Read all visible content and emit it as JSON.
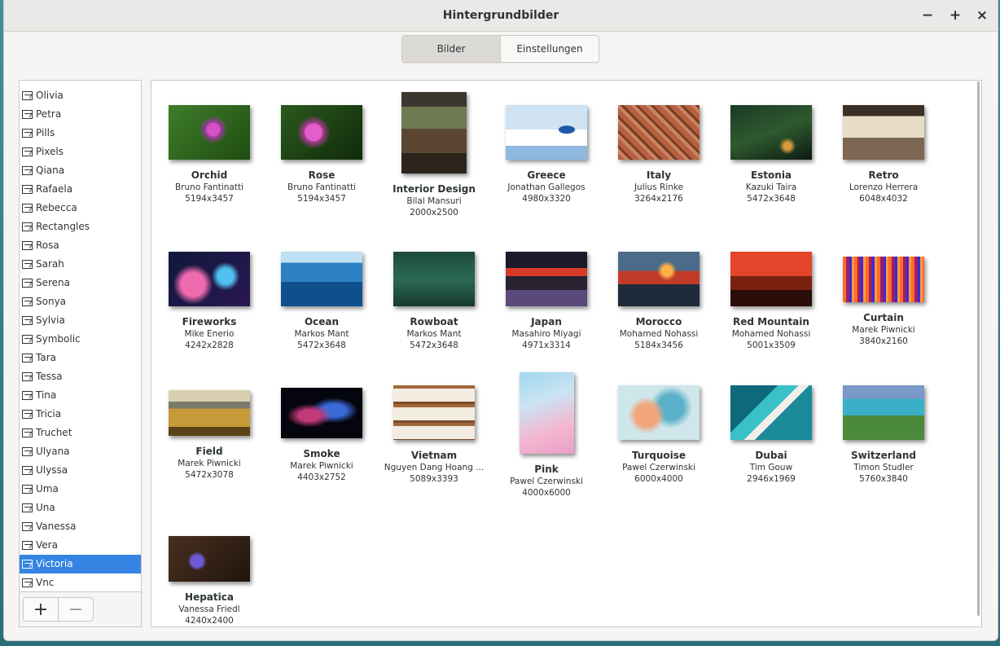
{
  "window": {
    "title": "Hintergrundbilder"
  },
  "controls": {
    "minimize": "−",
    "maximize": "+",
    "close": "×"
  },
  "tabs": [
    {
      "label": "Bilder",
      "active": true
    },
    {
      "label": "Einstellungen",
      "active": false
    }
  ],
  "sidebar": {
    "items": [
      "Olivia",
      "Petra",
      "Pills",
      "Pixels",
      "Qiana",
      "Rafaela",
      "Rebecca",
      "Rectangles",
      "Rosa",
      "Sarah",
      "Serena",
      "Sonya",
      "Sylvia",
      "Symbolic",
      "Tara",
      "Tessa",
      "Tina",
      "Tricia",
      "Truchet",
      "Ulyana",
      "Ulyssa",
      "Uma",
      "Una",
      "Vanessa",
      "Vera",
      "Victoria",
      "Vnc"
    ],
    "selected": "Victoria",
    "add_label": "+",
    "remove_label": "−"
  },
  "wallpapers": [
    {
      "name": "Orchid",
      "author": "Bruno Fantinatti",
      "size": "5194x3457"
    },
    {
      "name": "Rose",
      "author": "Bruno Fantinatti",
      "size": "5194x3457"
    },
    {
      "name": "Interior Design",
      "author": "Bilal Mansuri",
      "size": "2000x2500"
    },
    {
      "name": "Greece",
      "author": "Jonathan Gallegos",
      "size": "4980x3320"
    },
    {
      "name": "Italy",
      "author": "Julius Rinke",
      "size": "3264x2176"
    },
    {
      "name": "Estonia",
      "author": "Kazuki Taira",
      "size": "5472x3648"
    },
    {
      "name": "Retro",
      "author": "Lorenzo Herrera",
      "size": "6048x4032"
    },
    {
      "name": "Fireworks",
      "author": "Mike Enerio",
      "size": "4242x2828"
    },
    {
      "name": "Ocean",
      "author": "Markos Mant",
      "size": "5472x3648"
    },
    {
      "name": "Rowboat",
      "author": "Markos Mant",
      "size": "5472x3648"
    },
    {
      "name": "Japan",
      "author": "Masahiro Miyagi",
      "size": "4971x3314"
    },
    {
      "name": "Morocco",
      "author": "Mohamed Nohassi",
      "size": "5184x3456"
    },
    {
      "name": "Red Mountain",
      "author": "Mohamed Nohassi",
      "size": "5001x3509"
    },
    {
      "name": "Curtain",
      "author": "Marek Piwnicki",
      "size": "3840x2160"
    },
    {
      "name": "Field",
      "author": "Marek Piwnicki",
      "size": "5472x3078"
    },
    {
      "name": "Smoke",
      "author": "Marek Piwnicki",
      "size": "4403x2752"
    },
    {
      "name": "Vietnam",
      "author": "Nguyen Dang Hoang ...",
      "size": "5089x3393"
    },
    {
      "name": "Pink",
      "author": "Pawel Czerwinski",
      "size": "4000x6000"
    },
    {
      "name": "Turquoise",
      "author": "Pawel Czerwinski",
      "size": "6000x4000"
    },
    {
      "name": "Dubai",
      "author": "Tim Gouw",
      "size": "2946x1969"
    },
    {
      "name": "Switzerland",
      "author": "Timon Studler",
      "size": "5760x3840"
    },
    {
      "name": "Hepatica",
      "author": "Vanessa Friedl",
      "size": "4240x2400"
    }
  ],
  "colors": {
    "accent": "#3584e4",
    "window_bg": "#f6f5f4",
    "titlebar_bg": "#ebe9e7"
  }
}
